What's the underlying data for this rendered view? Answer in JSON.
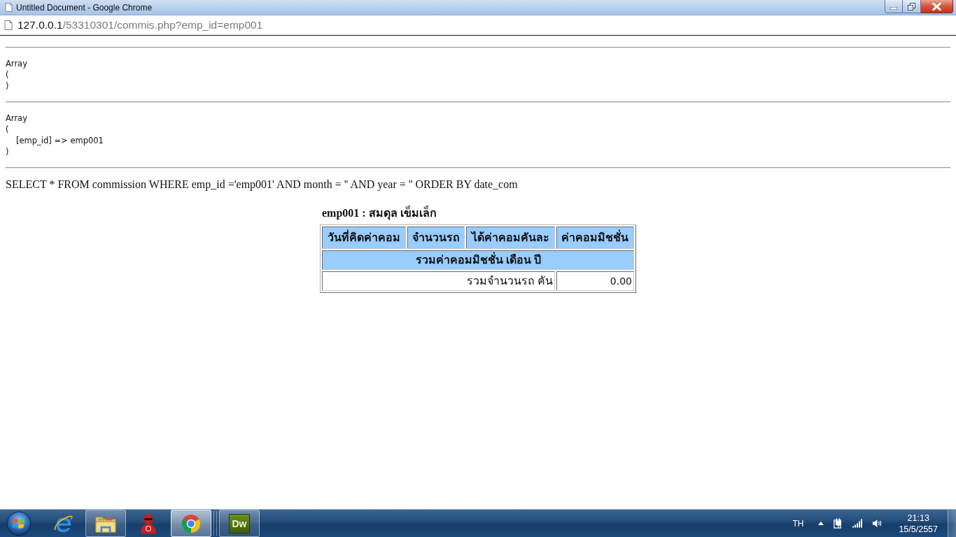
{
  "window": {
    "title": "Untitled Document - Google Chrome",
    "controls": [
      {
        "kind": "minimize"
      },
      {
        "kind": "restore"
      },
      {
        "kind": "close"
      }
    ]
  },
  "address_bar": {
    "host": "127.0.0.1",
    "path": "/53310301/commis.php?emp_id=emp001"
  },
  "page": {
    "debug_blocks": [
      {
        "header": "Array",
        "open": "(",
        "close": ")"
      },
      {
        "header": "Array",
        "open": "(",
        "entries": [
          "[emp_id] => emp001"
        ],
        "close": ")"
      }
    ],
    "query": "SELECT * FROM commission WHERE emp_id ='emp001' AND month = '' AND year = '' ORDER BY date_com",
    "report": {
      "title": "emp001 : สมดุล เข็มเล็ก",
      "table": {
        "columns": [
          "วันที่คิดค่าคอม",
          "จำนวนรถ",
          "ได้ค่าคอมคันละ",
          "ค่าคอมมิชชั่น"
        ],
        "summary_row": "รวมค่าคอมมิชชั่น เดือน ปี",
        "total_row": {
          "label": "รวมจำนวนรถ คัน",
          "value": "0.00"
        }
      }
    }
  },
  "taskbar": {
    "items": [
      {
        "kind": "elogo",
        "running": false,
        "selected": false
      },
      {
        "kind": "folder",
        "running": true,
        "selected": false
      },
      {
        "kind": "figure",
        "running": false,
        "selected": false
      },
      {
        "kind": "ringlogo",
        "running": true,
        "selected": true
      },
      {
        "kind": "tile",
        "label": "Dw",
        "running": true,
        "selected": false
      }
    ],
    "tray": {
      "language": "TH",
      "icons": [
        {
          "kind": "overflow"
        },
        {
          "kind": "power"
        },
        {
          "kind": "signal"
        },
        {
          "kind": "volume"
        }
      ],
      "time": "21:13",
      "date": "15/5/2557"
    }
  }
}
